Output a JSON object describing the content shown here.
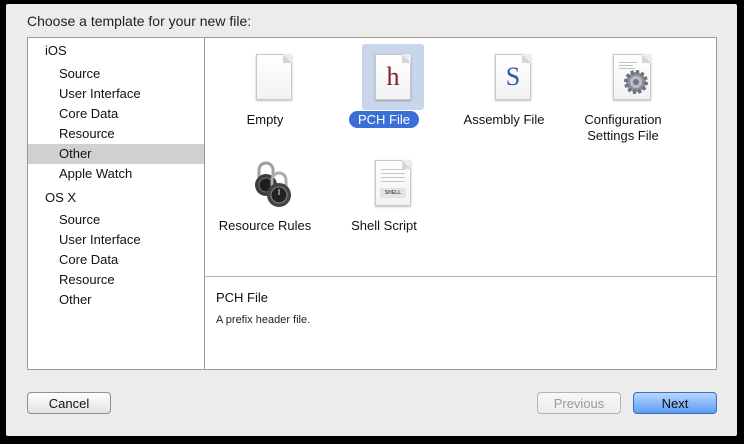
{
  "dialog": {
    "title": "Choose a template for your new file:"
  },
  "sidebar": {
    "groups": [
      {
        "label": "iOS",
        "items": [
          "Source",
          "User Interface",
          "Core Data",
          "Resource",
          "Other",
          "Apple Watch"
        ]
      },
      {
        "label": "OS X",
        "items": [
          "Source",
          "User Interface",
          "Core Data",
          "Resource",
          "Other"
        ]
      }
    ],
    "selected": "iOS / Other"
  },
  "templates": [
    {
      "label": "Empty",
      "icon": "blank-document-icon"
    },
    {
      "label": "PCH File",
      "icon": "header-h-document-icon",
      "glyph": "h",
      "glyph_color": "#8b1c2a",
      "selected": true
    },
    {
      "label": "Assembly File",
      "icon": "assembly-s-document-icon",
      "glyph": "S",
      "glyph_color": "#2a5aa0"
    },
    {
      "label": "Configuration Settings File",
      "label_line1": "Configuration",
      "label_line2": "Settings File",
      "icon": "settings-gear-document-icon"
    },
    {
      "label": "Resource Rules",
      "icon": "padlocks-icon"
    },
    {
      "label": "Shell Script",
      "icon": "shell-script-document-icon",
      "tag": "SHELL"
    }
  ],
  "description": {
    "title": "PCH File",
    "text": "A prefix header file."
  },
  "buttons": {
    "cancel": "Cancel",
    "previous": "Previous",
    "next": "Next"
  },
  "colors": {
    "selection_blue": "#3a6fd8",
    "sidebar_selection": "#d0d0d0"
  }
}
